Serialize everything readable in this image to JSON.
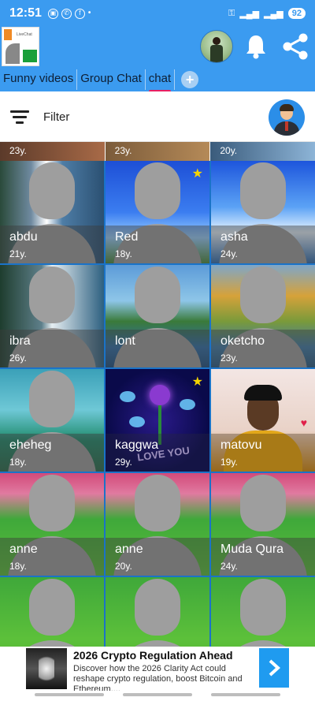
{
  "status_bar": {
    "time": "12:51",
    "battery": "92"
  },
  "header": {
    "tabs": [
      {
        "label": "Funny videos"
      },
      {
        "label": "Group Chat"
      },
      {
        "label": "chat"
      }
    ],
    "add_tab_icon": "plus-icon",
    "bell_icon": "bell-icon",
    "share_icon": "share-icon",
    "accent_color": "#3b9bf0",
    "active_tab_color": "#e82062"
  },
  "filter": {
    "label": "Filter"
  },
  "top_strip": [
    {
      "age": "23y."
    },
    {
      "age": "23y."
    },
    {
      "age": "20y."
    }
  ],
  "users": [
    {
      "name": "abdu",
      "age": "21y.",
      "star": false
    },
    {
      "name": "Red",
      "age": "18y.",
      "star": true
    },
    {
      "name": "asha",
      "age": "24y.",
      "star": false
    },
    {
      "name": "ibra",
      "age": "26y.",
      "star": false
    },
    {
      "name": "lont",
      "age": "",
      "star": false
    },
    {
      "name": "oketcho",
      "age": "23y.",
      "star": false
    },
    {
      "name": "eheheg",
      "age": "18y.",
      "star": false
    },
    {
      "name": "kaggwa",
      "age": "29y.",
      "star": true
    },
    {
      "name": "matovu",
      "age": "19y.",
      "star": false
    },
    {
      "name": "anne",
      "age": "18y.",
      "star": false
    },
    {
      "name": "anne",
      "age": "20y.",
      "star": false
    },
    {
      "name": "Muda Qura",
      "age": "24y.",
      "star": false
    }
  ],
  "star_glyph": "★",
  "ad": {
    "title": "2026 Crypto Regulation Ahead",
    "description": "Discover how the 2026 Clarity Act could reshape crypto regulation, boost Bitcoin and Ethereum,..."
  }
}
